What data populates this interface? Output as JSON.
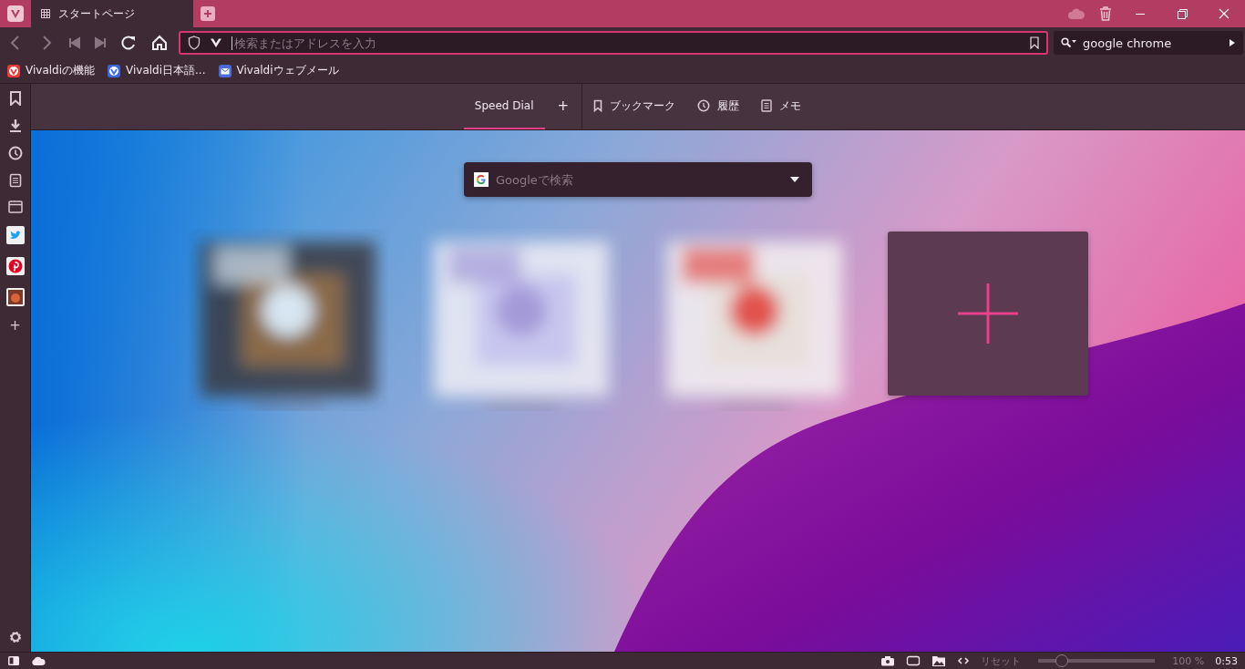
{
  "tabs": [
    {
      "label": "スタートページ",
      "selected": true
    }
  ],
  "address_bar": {
    "placeholder": "検索またはアドレスを入力"
  },
  "search_field": {
    "value": "google chrome"
  },
  "bookmarks": [
    {
      "label": "Vivaldiの機能",
      "kind": "vivaldi"
    },
    {
      "label": "Vivaldi日本語...",
      "kind": "community"
    },
    {
      "label": "Vivaldiウェブメール",
      "kind": "mail"
    }
  ],
  "sidebar": {
    "add": "+"
  },
  "panel_tabs": [
    {
      "label": "Speed Dial",
      "selected": true,
      "kind": "speed-dial"
    },
    {
      "label": "+",
      "selected": false,
      "kind": "add"
    },
    {
      "label": "ブックマーク",
      "selected": false,
      "kind": "bookmarks"
    },
    {
      "label": "履歴",
      "selected": false,
      "kind": "history"
    },
    {
      "label": "メモ",
      "selected": false,
      "kind": "notes"
    }
  ],
  "start_search": {
    "placeholder": "Googleで検索"
  },
  "speed_dials": [
    {
      "kind": "picture"
    },
    {
      "kind": "picture"
    },
    {
      "kind": "picture"
    },
    {
      "kind": "add"
    }
  ],
  "status_bar": {
    "reset": "リセット",
    "zoom": {
      "level": 0.2
    },
    "zoom_text": "100 %",
    "clock": "0:53"
  }
}
